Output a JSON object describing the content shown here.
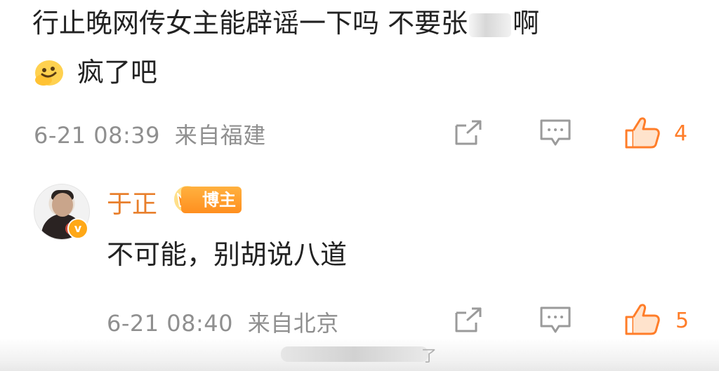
{
  "comment1": {
    "line1_pre": "行止晚网传女主能辟谣一下吗 不要张",
    "line1_post": "啊",
    "emoji_icon": "melting-face-icon",
    "line2": "疯了吧",
    "timestamp": "6-21 08:39",
    "location": "来自福建",
    "like_count": "4"
  },
  "reply": {
    "username": "于正",
    "badge_label": "博主",
    "verified_mark": "v",
    "text": "不可能，别胡说八道",
    "timestamp": "6-21 08:40",
    "location": "来自北京",
    "like_count": "5"
  },
  "watermark": {
    "text": "了"
  },
  "colors": {
    "accent": "#ff7d29",
    "username": "#e87f2c",
    "meta": "#8f8f8f",
    "icon": "#9a9a9a"
  }
}
